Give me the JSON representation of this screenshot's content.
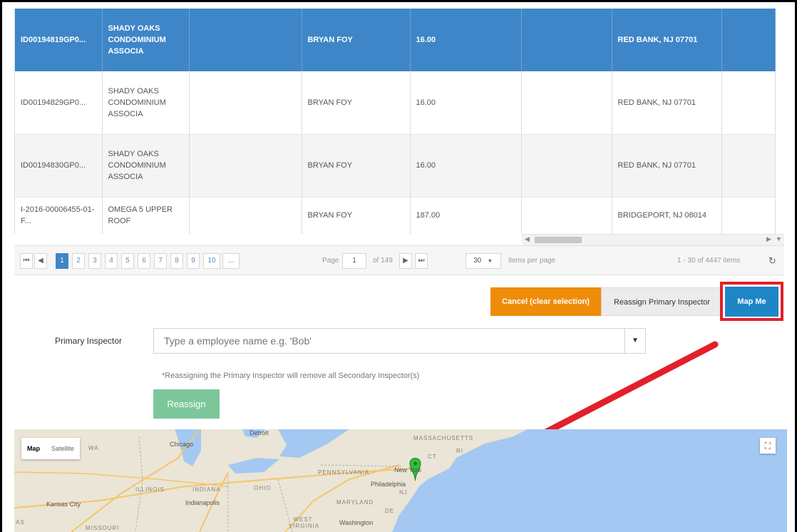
{
  "table": {
    "header": [
      "ID00194819GP0...",
      "SHADY OAKS CONDOMINIUM ASSOCIA",
      "",
      "BRYAN FOY",
      "16.00",
      "",
      "RED BANK, NJ 07701",
      ""
    ],
    "rows": [
      [
        "ID00194829GP0...",
        "SHADY OAKS CONDOMINIUM ASSOCIA",
        "",
        "BRYAN FOY",
        "16.00",
        "",
        "RED BANK, NJ 07701",
        ""
      ],
      [
        "ID00194830GP0...",
        "SHADY OAKS CONDOMINIUM ASSOCIA",
        "",
        "BRYAN FOY",
        "16.00",
        "",
        "RED BANK, NJ 07701",
        ""
      ],
      [
        "I-2016-00006455-01-F...",
        "OMEGA 5 UPPER ROOF",
        "",
        "BRYAN FOY",
        "187.00",
        "",
        "BRIDGEPORT, NJ 08014",
        ""
      ]
    ]
  },
  "pager": {
    "first": "⏮",
    "prev": "◀",
    "pages": [
      "1",
      "2",
      "3",
      "4",
      "5",
      "6",
      "7",
      "8",
      "9",
      "10",
      "..."
    ],
    "active_page": "1",
    "page_label": "Page",
    "page_value": "1",
    "of_label": "of 149",
    "next": "▶",
    "last": "⏭",
    "page_size": "30",
    "page_size_arrow": "▼",
    "per_page_label": "items per page",
    "summary": "1 - 30 of 4447 items",
    "refresh_icon": "↻"
  },
  "actions": {
    "cancel": "Cancel (clear selection)",
    "reassign_primary": "Reassign Primary Inspector",
    "map_me": "Map Me"
  },
  "form": {
    "primary_inspector_label": "Primary Inspector",
    "primary_inspector_placeholder": "Type a employee name e.g. 'Bob'",
    "dropdown_arrow": "▼",
    "note": "*Reassigning the Primary Inspector will remove all Secondary Inspector(s)",
    "reassign_button": "Reassign"
  },
  "map": {
    "type_map": "Map",
    "type_satellite": "Satellite",
    "fullscreen_icon": "⛶",
    "labels": {
      "detroit": "Detroit",
      "chicago": "Chicago",
      "massachusetts": "MASSACHUSETTS",
      "ct": "CT",
      "ri": "RI",
      "pennsylvania": "PENNSYLVANIA",
      "new_york": "New York",
      "philadelphia": "Philadelphia",
      "nj": "NJ",
      "illinois": "ILLINOIS",
      "indiana": "INDIANA",
      "ohio": "OHIO",
      "indianapolis": "Indianapolis",
      "kansas_city": "Kansas City",
      "maryland": "MARYLAND",
      "de": "DE",
      "west_virginia": "WEST VIRGINIA",
      "washington": "Washington",
      "missouri": "MISSOURI",
      "iowa": "WA",
      "kansas": "AS"
    }
  },
  "colors": {
    "header_blue": "#3e86c8",
    "cancel_orange": "#ef8c0a",
    "mapme_blue": "#1f86c6",
    "highlight_red": "#e2202a",
    "reassign_green": "#7cc79a",
    "water": "#a4c8f2"
  }
}
